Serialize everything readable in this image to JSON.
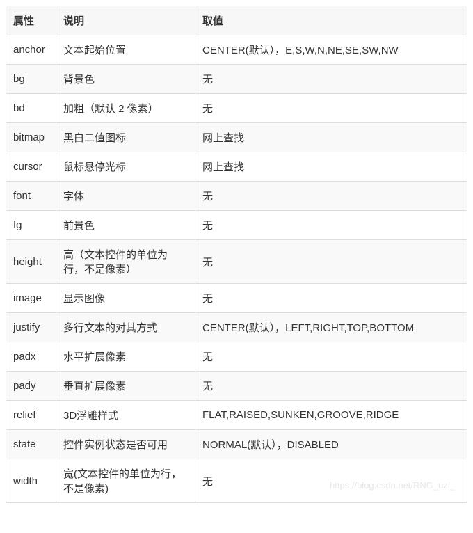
{
  "headers": {
    "attr": "属性",
    "desc": "说明",
    "value": "取值"
  },
  "rows": [
    {
      "attr": "anchor",
      "desc": "文本起始位置",
      "value": "CENTER(默认），E,S,W,N,NE,SE,SW,NW"
    },
    {
      "attr": "bg",
      "desc": "背景色",
      "value": "无"
    },
    {
      "attr": "bd",
      "desc": "加粗（默认 2 像素）",
      "value": "无"
    },
    {
      "attr": "bitmap",
      "desc": "黑白二值图标",
      "value": "网上查找"
    },
    {
      "attr": "cursor",
      "desc": "鼠标悬停光标",
      "value": "网上查找"
    },
    {
      "attr": "font",
      "desc": "字体",
      "value": "无"
    },
    {
      "attr": "fg",
      "desc": "前景色",
      "value": "无"
    },
    {
      "attr": "height",
      "desc": "高（文本控件的单位为行，不是像素）",
      "value": "无"
    },
    {
      "attr": "image",
      "desc": "显示图像",
      "value": "无"
    },
    {
      "attr": "justify",
      "desc": "多行文本的对其方式",
      "value": "CENTER(默认），LEFT,RIGHT,TOP,BOTTOM"
    },
    {
      "attr": "padx",
      "desc": "水平扩展像素",
      "value": "无"
    },
    {
      "attr": "pady",
      "desc": "垂直扩展像素",
      "value": "无"
    },
    {
      "attr": "relief",
      "desc": "3D浮雕样式",
      "value": "FLAT,RAISED,SUNKEN,GROOVE,RIDGE"
    },
    {
      "attr": "state",
      "desc": "控件实例状态是否可用",
      "value": "NORMAL(默认），DISABLED"
    },
    {
      "attr": "width",
      "desc": "宽(文本控件的单位为行，不是像素)",
      "value": "无"
    }
  ],
  "watermark": "https://blog.csdn.net/RNG_uzi_",
  "chart_data": {
    "type": "table",
    "title": "",
    "columns": [
      "属性",
      "说明",
      "取值"
    ],
    "data": [
      [
        "anchor",
        "文本起始位置",
        "CENTER(默认），E,S,W,N,NE,SE,SW,NW"
      ],
      [
        "bg",
        "背景色",
        "无"
      ],
      [
        "bd",
        "加粗（默认 2 像素）",
        "无"
      ],
      [
        "bitmap",
        "黑白二值图标",
        "网上查找"
      ],
      [
        "cursor",
        "鼠标悬停光标",
        "网上查找"
      ],
      [
        "font",
        "字体",
        "无"
      ],
      [
        "fg",
        "前景色",
        "无"
      ],
      [
        "height",
        "高（文本控件的单位为行，不是像素）",
        "无"
      ],
      [
        "image",
        "显示图像",
        "无"
      ],
      [
        "justify",
        "多行文本的对其方式",
        "CENTER(默认），LEFT,RIGHT,TOP,BOTTOM"
      ],
      [
        "padx",
        "水平扩展像素",
        "无"
      ],
      [
        "pady",
        "垂直扩展像素",
        "无"
      ],
      [
        "relief",
        "3D浮雕样式",
        "FLAT,RAISED,SUNKEN,GROOVE,RIDGE"
      ],
      [
        "state",
        "控件实例状态是否可用",
        "NORMAL(默认），DISABLED"
      ],
      [
        "width",
        "宽(文本控件的单位为行，不是像素)",
        "无"
      ]
    ]
  }
}
